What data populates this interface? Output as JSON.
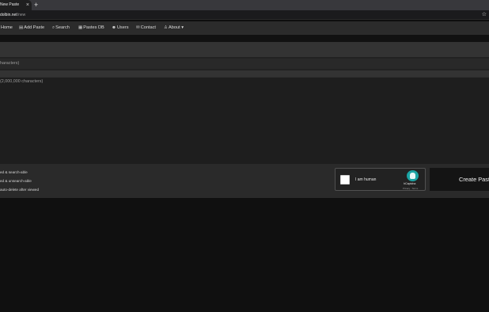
{
  "browser": {
    "tab_title": "New Paste",
    "close_glyph": "×",
    "new_tab_glyph": "+",
    "url_host": "dolbin.net",
    "url_path": "/new",
    "star_glyph": "☆"
  },
  "nav": {
    "items": [
      {
        "label": "Home",
        "icon": "home-icon"
      },
      {
        "label": "Add Paste",
        "icon": "add-file-icon",
        "glyph": "▤"
      },
      {
        "label": "Search",
        "icon": "search-icon",
        "glyph": "⌕"
      },
      {
        "label": "Pastes DB",
        "icon": "database-icon",
        "glyph": "▦"
      },
      {
        "label": "Users",
        "icon": "users-icon",
        "glyph": "☻"
      },
      {
        "label": "Contact",
        "icon": "envelope-icon",
        "glyph": "✉"
      },
      {
        "label": "About",
        "icon": "user-icon",
        "glyph": "♙",
        "caret": "▾"
      }
    ]
  },
  "form": {
    "title_placeholder": "haracters)",
    "content_placeholder": "(2,000,000 characters)"
  },
  "visibility_options": [
    "ed & search-able",
    "ed & unsearch-able",
    "auto-delete after viewed"
  ],
  "captcha": {
    "label": "I am human",
    "brand": "hCaptcha",
    "links": "Privacy · Terms"
  },
  "submit": {
    "label": "Create Paste"
  },
  "colors": {
    "page_bg": "#101010",
    "navbar_bg": "#2b2b2b",
    "captcha_brand": "#1aa3a3"
  }
}
